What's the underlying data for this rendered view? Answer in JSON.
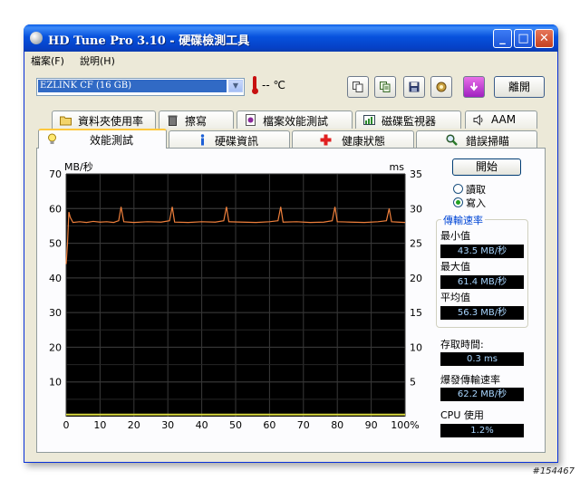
{
  "window": {
    "title": "HD Tune Pro 3.10 - 硬碟檢測工具",
    "minimize_label": "_",
    "maximize_label": "□",
    "close_label": "✕"
  },
  "menu": {
    "items": [
      "檔案(F)",
      "說明(H)"
    ]
  },
  "toolbar": {
    "drive_value": "EZLINK CF (16 GB)",
    "temperature": "-- ℃",
    "exit_label": "離開",
    "icons": [
      "copy-icon",
      "copy-text-icon",
      "save-icon",
      "options-icon",
      "download-icon"
    ]
  },
  "tabs": {
    "row1": [
      {
        "label": "資料夾使用率",
        "icon": "folder-icon"
      },
      {
        "label": "擦寫",
        "icon": "trash-icon"
      },
      {
        "label": "檔案效能測試",
        "icon": "file-benchmark-icon"
      },
      {
        "label": "磁碟監視器",
        "icon": "disk-monitor-icon"
      },
      {
        "label": "AAM",
        "icon": "speaker-icon"
      }
    ],
    "row2": [
      {
        "label": "效能測試",
        "icon": "lightbulb-icon",
        "active": true
      },
      {
        "label": "硬碟資訊",
        "icon": "info-icon"
      },
      {
        "label": "健康狀態",
        "icon": "health-cross-icon"
      },
      {
        "label": "錯誤掃瞄",
        "icon": "magnifier-icon"
      }
    ]
  },
  "controls": {
    "start_label": "開始",
    "read_label": "讀取",
    "write_label": "寫入",
    "selected_mode": "寫入"
  },
  "stats": {
    "transfer_group": "傳輸速率",
    "min_label": "最小值",
    "min_value": "43.5 MB/秒",
    "max_label": "最大值",
    "max_value": "61.4 MB/秒",
    "avg_label": "平均值",
    "avg_value": "56.3 MB/秒",
    "access_label": "存取時間:",
    "access_value": "0.3 ms",
    "burst_label": "爆發傳輸速率",
    "burst_value": "62.2 MB/秒",
    "cpu_label": "CPU 使用",
    "cpu_value": "1.2%"
  },
  "watermark": "#154467",
  "colors": {
    "title_bar": "#0752dd",
    "chart_background": "#000000",
    "grid": "#3a3a3a",
    "transfer_line": "#f0803c",
    "access_points": "#d8d840",
    "stat_text": "#a9d6ff"
  },
  "chart_data": {
    "type": "line",
    "title": "",
    "ylabel": "MB/秒",
    "y2label": "ms",
    "xlabel": "",
    "x_ticks": [
      "0",
      "10",
      "20",
      "30",
      "40",
      "50",
      "60",
      "70",
      "80",
      "90",
      "100%"
    ],
    "y_ticks": [
      10,
      20,
      30,
      40,
      50,
      60,
      70
    ],
    "y2_ticks": [
      5,
      10,
      15,
      20,
      25,
      30,
      35
    ],
    "ylim": [
      0,
      70
    ],
    "y2lim": [
      0,
      35
    ],
    "xlim": [
      0,
      100
    ],
    "grid": true,
    "series": [
      {
        "axis": "left",
        "x": [
          0,
          0.4,
          0.8,
          1.2,
          2,
          4,
          6,
          8,
          10,
          12,
          14,
          15.5,
          16.2,
          17,
          20,
          24,
          28,
          30.5,
          31.3,
          32,
          36,
          40,
          44,
          46.5,
          47.3,
          48,
          52,
          56,
          60,
          62.5,
          63.3,
          64,
          68,
          72,
          76,
          78.5,
          79.3,
          80,
          84,
          88,
          92,
          94.5,
          95.3,
          96,
          98,
          100
        ],
        "values": [
          44,
          50,
          59,
          57.5,
          56,
          56.2,
          56,
          56.3,
          56.1,
          56.2,
          56,
          56.5,
          60.5,
          56.2,
          56,
          56.2,
          56.1,
          56.5,
          60.5,
          56.1,
          56,
          56.2,
          56.1,
          56.5,
          60.5,
          56.2,
          56.1,
          56,
          56.2,
          56.5,
          60.5,
          56.1,
          56.2,
          56,
          56.1,
          56.5,
          60.5,
          56.2,
          56.1,
          56,
          56.2,
          56.5,
          60,
          56.2,
          56.1,
          56
        ]
      },
      {
        "axis": "right",
        "x": [
          0,
          5,
          10,
          15,
          20,
          25,
          30,
          35,
          40,
          45,
          50,
          55,
          60,
          65,
          70,
          75,
          80,
          85,
          90,
          95,
          100
        ],
        "values": [
          0.3,
          0.3,
          0.3,
          0.3,
          0.3,
          0.3,
          0.3,
          0.3,
          0.3,
          0.3,
          0.3,
          0.3,
          0.3,
          0.3,
          0.3,
          0.3,
          0.3,
          0.3,
          0.3,
          0.3,
          0.3
        ]
      }
    ]
  }
}
